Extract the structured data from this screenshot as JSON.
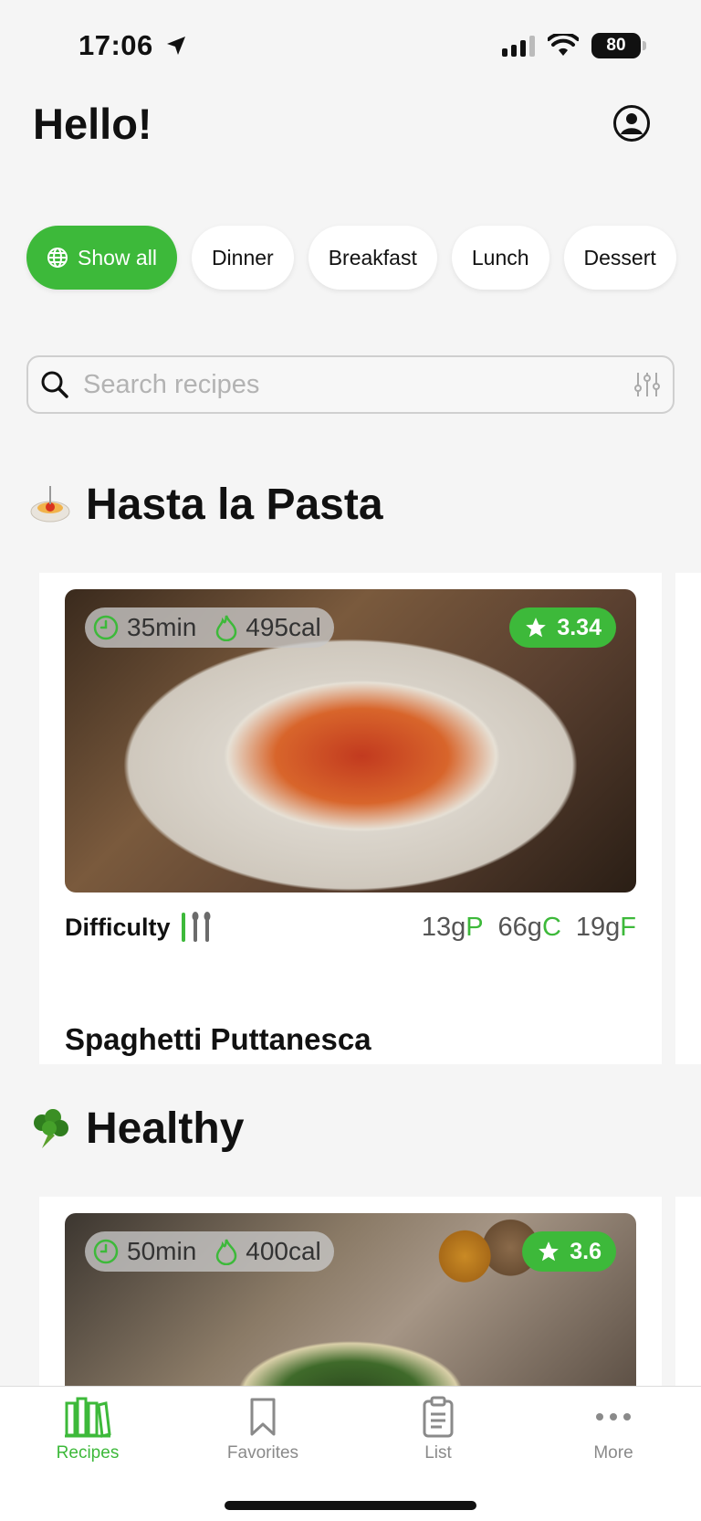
{
  "status_bar": {
    "time": "17:06",
    "battery": "80"
  },
  "header": {
    "greeting": "Hello!"
  },
  "categories": [
    {
      "label": "Show all",
      "active": true
    },
    {
      "label": "Dinner",
      "active": false
    },
    {
      "label": "Breakfast",
      "active": false
    },
    {
      "label": "Lunch",
      "active": false
    },
    {
      "label": "Dessert",
      "active": false
    }
  ],
  "search": {
    "placeholder": "Search recipes"
  },
  "sections": [
    {
      "title": "Hasta la Pasta",
      "emoji_icon": "pasta-bowl-icon",
      "recipe": {
        "name": "Spaghetti Puttanesca",
        "time": "35min",
        "calories": "495cal",
        "rating": "3.34",
        "difficulty_label": "Difficulty",
        "difficulty_level": 1,
        "difficulty_max": 3,
        "protein": "13g",
        "protein_unit": "P",
        "carbs": "66g",
        "carbs_unit": "C",
        "fat": "19g",
        "fat_unit": "F"
      }
    },
    {
      "title": "Healthy",
      "emoji_icon": "broccoli-icon",
      "recipe": {
        "time": "50min",
        "calories": "400cal",
        "rating": "3.6"
      }
    }
  ],
  "tabs": [
    {
      "label": "Recipes",
      "icon": "books-icon",
      "active": true
    },
    {
      "label": "Favorites",
      "icon": "bookmark-icon",
      "active": false
    },
    {
      "label": "List",
      "icon": "clipboard-icon",
      "active": false
    },
    {
      "label": "More",
      "icon": "more-dots-icon",
      "active": false
    }
  ],
  "colors": {
    "accent": "#3db93a",
    "background": "#f5f5f5"
  }
}
